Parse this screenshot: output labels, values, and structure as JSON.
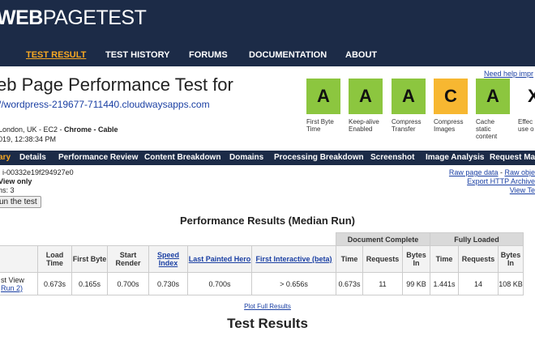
{
  "logo": {
    "bold": "WEB",
    "rest": "PAGETEST"
  },
  "nav": [
    {
      "label": "TEST RESULT"
    },
    {
      "label": "TEST HISTORY"
    },
    {
      "label": "FORUMS"
    },
    {
      "label": "DOCUMENTATION"
    },
    {
      "label": "ABOUT"
    }
  ],
  "help_link": "Need help impr",
  "title": "eb Page Performance Test for",
  "url": "//wordpress-219677-711440.cloudwaysapps.com",
  "location": {
    "line1_prefix": " London, UK - EC2 - ",
    "browser": "Chrome - Cable",
    "line2": "019, 12:38:34 PM"
  },
  "grades": [
    {
      "letter": "A",
      "label": "First Byte Time",
      "color": "#8cc63f"
    },
    {
      "letter": "A",
      "label": "Keep-alive Enabled",
      "color": "#8cc63f"
    },
    {
      "letter": "A",
      "label": "Compress Transfer",
      "color": "#8cc63f"
    },
    {
      "letter": "C",
      "label": "Compress Images",
      "color": "#f7b731"
    },
    {
      "letter": "A",
      "label": "Cache static content",
      "color": "#8cc63f"
    },
    {
      "letter": "X",
      "label": "Effec use o"
    }
  ],
  "subnav": [
    "ary",
    "Details",
    "Performance Review",
    "Content Breakdown",
    "Domains",
    "Processing Breakdown",
    "Screenshot",
    "Image Analysis",
    "Request Ma"
  ],
  "meta": {
    "id": ": i-00332e19f294927e0",
    "view": "View only",
    "runs": "ns: 3",
    "rerun": "un the test"
  },
  "right_links": {
    "raw_page": "Raw page data",
    "sep": " - ",
    "raw_obj": "Raw obje",
    "export": "Export HTTP Archive",
    "view": "View Te"
  },
  "perf_title": "Performance Results (Median Run)",
  "table": {
    "group_doc": "Document Complete",
    "group_full": "Fully Loaded",
    "headers": {
      "load_time": "Load Time",
      "first_byte": "First Byte",
      "start_render": "Start Render",
      "speed_index": "Speed Index",
      "last_painted": "Last Painted Hero",
      "first_interactive": "First Interactive (beta)",
      "time": "Time",
      "requests": "Requests",
      "bytes_in": "Bytes In"
    },
    "row": {
      "label1": "st View",
      "label2": "Run 2)",
      "load_time": "0.673s",
      "first_byte": "0.165s",
      "start_render": "0.700s",
      "speed_index": "0.730s",
      "last_painted": "0.700s",
      "first_interactive": "> 0.656s",
      "doc_time": "0.673s",
      "doc_requests": "11",
      "doc_bytes": "99 KB",
      "full_time": "1.441s",
      "full_requests": "14",
      "full_bytes": "108 KB"
    }
  },
  "plot_link": "Plot Full Results",
  "test_results": "Test Results"
}
